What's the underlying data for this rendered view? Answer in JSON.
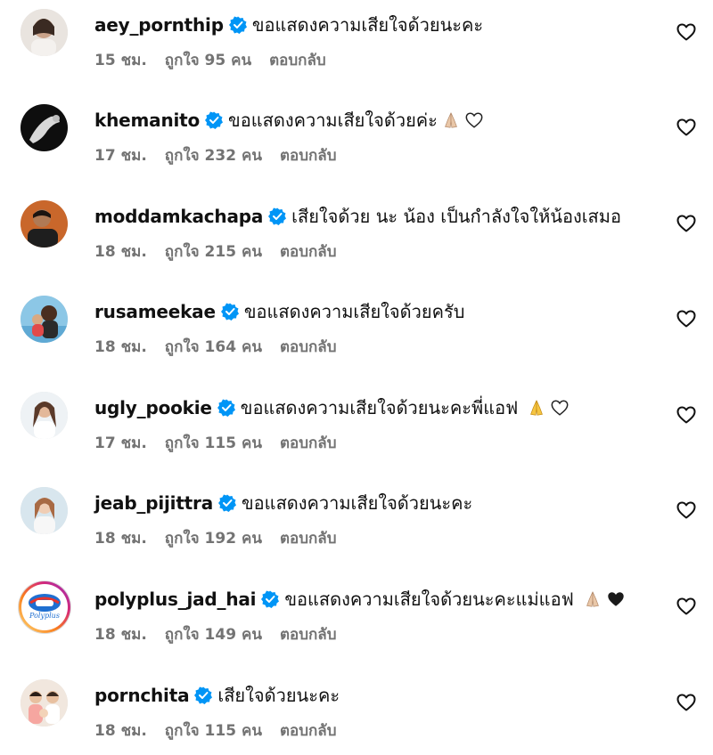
{
  "comments": [
    {
      "username": "aey_pornthip",
      "text": "ขอแสดงความเสียใจด้วยนะคะ",
      "time": "15 ชม.",
      "likes": "ถูกใจ 95 คน",
      "reply": "ตอบกลับ",
      "emojis": [],
      "avatar": "portrait-woman-light"
    },
    {
      "username": "khemanito",
      "text": "ขอแสดงความเสียใจด้วยค่ะ",
      "time": "17 ชม.",
      "likes": "ถูกใจ 232 คน",
      "reply": "ตอบกลับ",
      "emojis": [
        "folded-hands",
        "white-heart"
      ],
      "avatar": "dark-silhouette"
    },
    {
      "username": "moddamkachapa",
      "text": "เสียใจด้วย นะ น้อง เป็นกำลังใจให้น้องเสมอ",
      "time": "18 ชม.",
      "likes": "ถูกใจ 215 คน",
      "reply": "ตอบกลับ",
      "emojis": [],
      "avatar": "portrait-man-orange"
    },
    {
      "username": "rusameekae",
      "text": "ขอแสดงความเสียใจด้วยครับ",
      "time": "18 ชม.",
      "likes": "ถูกใจ 164 คน",
      "reply": "ตอบกลับ",
      "emojis": [],
      "avatar": "two-people-sky"
    },
    {
      "username": "ugly_pookie",
      "text": "ขอแสดงความเสียใจด้วยนะคะพี่แอฟ",
      "time": "17 ชม.",
      "likes": "ถูกใจ 115 คน",
      "reply": "ตอบกลับ",
      "emojis": [
        "folded-hands-yellow",
        "white-heart"
      ],
      "avatar": "portrait-woman-light"
    },
    {
      "username": "jeab_pijittra",
      "text": "ขอแสดงความเสียใจด้วยนะคะ",
      "time": "18 ชม.",
      "likes": "ถูกใจ 192 คน",
      "reply": "ตอบกลับ",
      "emojis": [],
      "avatar": "portrait-woman-light"
    },
    {
      "username": "polyplus_jad_hai",
      "text": "ขอแสดงความเสียใจด้วยนะคะแม่แอฟ",
      "time": "18 ชม.",
      "likes": "ถูกใจ 149 คน",
      "reply": "ตอบกลับ",
      "emojis": [
        "folded-hands",
        "black-heart"
      ],
      "avatar": "polyplus-logo"
    },
    {
      "username": "pornchita",
      "text": "เสียใจด้วยนะคะ",
      "time": "18 ชม.",
      "likes": "ถูกใจ 115 คน",
      "reply": "ตอบกลับ",
      "emojis": [],
      "avatar": "family-photo"
    }
  ],
  "colors": {
    "verified": "#0095f6",
    "meta_text": "#737373",
    "text": "#111111"
  }
}
